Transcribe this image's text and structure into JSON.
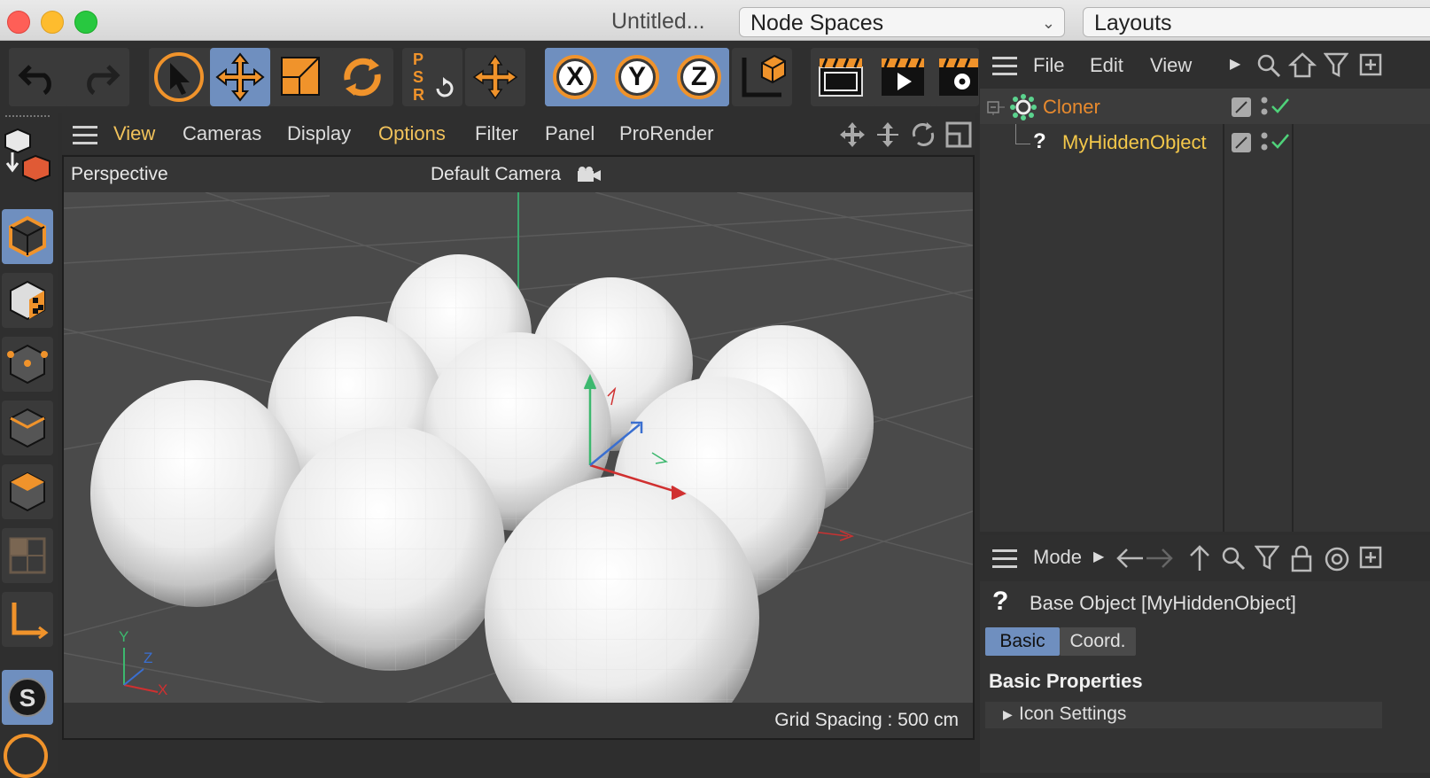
{
  "window": {
    "title": "Untitled...",
    "node_spaces": "Node Spaces",
    "layouts": "Layouts",
    "traffic_colors": [
      "#fe5f57",
      "#febc2e",
      "#28c840"
    ]
  },
  "toolbar": {
    "psr_letters": [
      "P",
      "S",
      "R"
    ],
    "axis_x": "X",
    "axis_y": "Y",
    "axis_z": "Z"
  },
  "viewport": {
    "menu": {
      "view": "View",
      "cameras": "Cameras",
      "display": "Display",
      "options": "Options",
      "filter": "Filter",
      "panel": "Panel",
      "prorender": "ProRender"
    },
    "mode": "Perspective",
    "camera": "Default Camera",
    "grid_spacing": "Grid Spacing : 500 cm",
    "axis_labels": {
      "y": "Y",
      "z": "Z",
      "x": "X"
    },
    "highlight_color": "#f1c25b"
  },
  "object_manager": {
    "menu": {
      "file": "File",
      "edit": "Edit",
      "view": "View"
    },
    "objects": [
      {
        "name": "Cloner",
        "color": "#e88a2e"
      },
      {
        "name": "MyHiddenObject",
        "color": "#f4c84a"
      }
    ]
  },
  "attribute_manager": {
    "menu": {
      "mode": "Mode"
    },
    "object_title": "Base Object [MyHiddenObject]",
    "tabs": {
      "basic": "Basic",
      "coord": "Coord."
    },
    "section": "Basic Properties",
    "group": "Icon Settings"
  }
}
